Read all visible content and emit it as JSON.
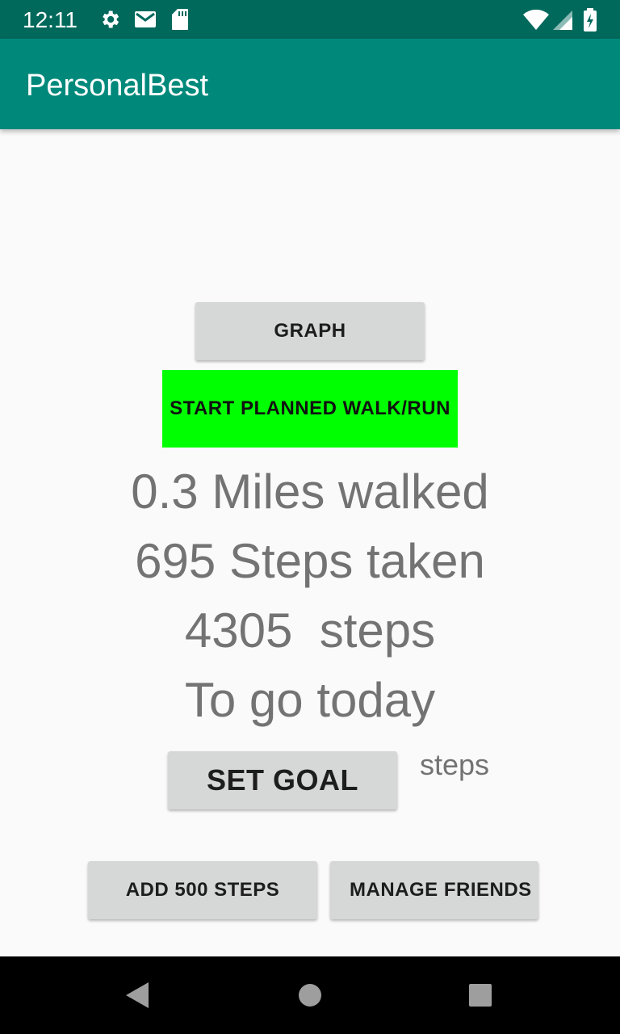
{
  "status_bar": {
    "time": "12:11",
    "icons_left": [
      "settings-gear-icon",
      "mail-icon",
      "sd-card-icon"
    ],
    "icons_right": [
      "wifi-icon",
      "cell-signal-icon",
      "battery-charging-icon"
    ],
    "background": "#00695c"
  },
  "app_bar": {
    "title": "PersonalBest",
    "background": "#00897b"
  },
  "main": {
    "graph_button": "GRAPH",
    "start_button": "START PLANNED WALK/RUN",
    "start_button_color": "#00ff00",
    "miles_walked": "0.3 Miles walked",
    "steps_taken": "695 Steps taken",
    "steps_remaining": "4305  steps",
    "to_go_today": "To go today",
    "set_goal_button": "SET GOAL",
    "goal_unit_label": "steps",
    "add_steps_button": "ADD 500 STEPS",
    "manage_friends_button": "MANAGE FRIENDS"
  },
  "nav_bar": {
    "icons": [
      "back-icon",
      "home-icon",
      "recents-icon"
    ]
  }
}
